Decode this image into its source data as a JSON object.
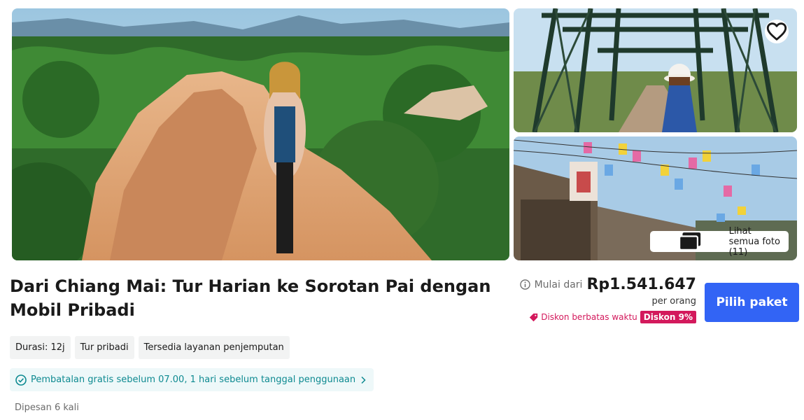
{
  "gallery": {
    "see_all_label": "Lihat semua foto (11)"
  },
  "activity": {
    "title": "Dari Chiang Mai: Tur Harian ke Sorotan Pai dengan Mobil Pribadi",
    "tags": [
      "Durasi: 12j",
      "Tur pribadi",
      "Tersedia layanan penjemputan"
    ],
    "cancellation": "Pembatalan gratis sebelum 07.00, 1 hari sebelum tanggal penggunaan",
    "booked_count": "Dipesan 6 kali"
  },
  "pricing": {
    "from_label": "Mulai dari",
    "price": "Rp1.541.647",
    "per_person": "per orang",
    "discount_label": "Diskon berbatas waktu",
    "discount_badge": "Diskon 9%",
    "choose_button": "Pilih paket"
  },
  "colors": {
    "primary": "#3264f5",
    "discount": "#d3195c",
    "teal": "#0e8a91"
  },
  "icons": {
    "favorite": "heart-icon",
    "gallery": "images-icon",
    "info": "info-icon",
    "tag": "tag-icon",
    "check": "check-circle-icon",
    "chevron": "chevron-right-icon"
  }
}
